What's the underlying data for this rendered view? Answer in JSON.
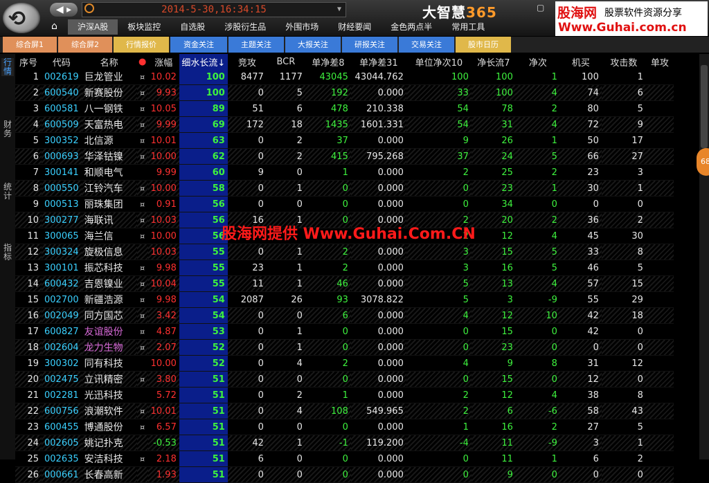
{
  "header": {
    "datetime": "2014-5-30,16:34:15",
    "brand_main": "大智慧",
    "brand_num": "365",
    "watermark_title": "股海网",
    "watermark_sub": "股票软件资源分享",
    "watermark_url": "Www.Guhai.com.cn",
    "menu": [
      "沪深A股",
      "板块监控",
      "自选股",
      "涉股衍生品",
      "外围市场",
      "财经要闻",
      "金色两点半",
      "常用工具"
    ],
    "active_menu": 0
  },
  "tabs": [
    {
      "label": "综合屏1",
      "color": "#e0905a"
    },
    {
      "label": "综合屏2",
      "color": "#e0905a"
    },
    {
      "label": "行情报价",
      "color": "#e0b84a"
    },
    {
      "label": "资金关注",
      "color": "#3a7ad8"
    },
    {
      "label": "主题关注",
      "color": "#3a7ad8"
    },
    {
      "label": "大报关注",
      "color": "#3a7ad8"
    },
    {
      "label": "研报关注",
      "color": "#3a7ad8"
    },
    {
      "label": "交易关注",
      "color": "#3a7ad8"
    },
    {
      "label": "股市日历",
      "color": "#e0b84a"
    }
  ],
  "leftnav": [
    "行情",
    "财务",
    "统计",
    "指标"
  ],
  "table": {
    "headers": [
      "序号",
      "代码",
      "名称",
      "●",
      "涨幅",
      "细水长流↓",
      "竞攻",
      "BCR",
      "单净差8",
      "单净差31",
      "单位净次10",
      "净长流7",
      "净次",
      "机买",
      "攻击数",
      "单攻"
    ],
    "rows": [
      [
        "1",
        "002619",
        "巨龙管业",
        "¤",
        "10.02",
        "100",
        "8477",
        "1177",
        "43045",
        "43044.762",
        "100",
        "100",
        "1",
        "100",
        "1"
      ],
      [
        "2",
        "600540",
        "新赛股份",
        "¤",
        "9.93",
        "100",
        "0",
        "5",
        "192",
        "0.000",
        "33",
        "100",
        "4",
        "74",
        "6"
      ],
      [
        "3",
        "600581",
        "八一钢铁",
        "¤",
        "10.05",
        "89",
        "51",
        "6",
        "478",
        "210.338",
        "54",
        "78",
        "2",
        "80",
        "5"
      ],
      [
        "4",
        "600509",
        "天富热电",
        "¤",
        "9.99",
        "69",
        "172",
        "18",
        "1435",
        "1601.331",
        "54",
        "31",
        "4",
        "72",
        "9"
      ],
      [
        "5",
        "300352",
        "北信源",
        "¤",
        "10.01",
        "63",
        "0",
        "2",
        "37",
        "0.000",
        "9",
        "26",
        "1",
        "50",
        "17"
      ],
      [
        "6",
        "000693",
        "华泽钴镍",
        "¤",
        "10.00",
        "62",
        "0",
        "2",
        "415",
        "795.268",
        "37",
        "24",
        "5",
        "66",
        "27"
      ],
      [
        "7",
        "300141",
        "和顺电气",
        "",
        "9.99",
        "60",
        "9",
        "0",
        "1",
        "0.000",
        "2",
        "25",
        "2",
        "23",
        "3"
      ],
      [
        "8",
        "000550",
        "江铃汽车",
        "¤",
        "10.00",
        "58",
        "0",
        "1",
        "0",
        "0.000",
        "0",
        "23",
        "1",
        "30",
        "1"
      ],
      [
        "9",
        "000513",
        "丽珠集团",
        "¤",
        "0.91",
        "56",
        "0",
        "0",
        "0",
        "0.000",
        "0",
        "34",
        "0",
        "0",
        "0"
      ],
      [
        "10",
        "300277",
        "海联讯",
        "¤",
        "10.03",
        "56",
        "16",
        "1",
        "0",
        "0.000",
        "2",
        "20",
        "2",
        "36",
        "2"
      ],
      [
        "11",
        "300065",
        "海兰信",
        "¤",
        "10.00",
        "56",
        "",
        "",
        "",
        "",
        "2",
        "12",
        "4",
        "45",
        "30"
      ],
      [
        "12",
        "300324",
        "旋极信息",
        "",
        "10.03",
        "55",
        "0",
        "1",
        "2",
        "0.000",
        "3",
        "15",
        "5",
        "33",
        "8"
      ],
      [
        "13",
        "300101",
        "振芯科技",
        "¤",
        "9.98",
        "55",
        "23",
        "1",
        "2",
        "0.000",
        "3",
        "16",
        "5",
        "46",
        "5"
      ],
      [
        "14",
        "600432",
        "吉恩镍业",
        "¤",
        "10.04",
        "55",
        "11",
        "1",
        "46",
        "0.000",
        "5",
        "13",
        "4",
        "57",
        "15"
      ],
      [
        "15",
        "002700",
        "新疆浩源",
        "¤",
        "9.98",
        "54",
        "2087",
        "26",
        "93",
        "3078.822",
        "5",
        "3",
        "-9",
        "55",
        "29"
      ],
      [
        "16",
        "002049",
        "同方国芯",
        "¤",
        "3.42",
        "54",
        "0",
        "0",
        "6",
        "0.000",
        "4",
        "12",
        "10",
        "42",
        "18"
      ],
      [
        "17",
        "600827",
        "友谊股份",
        "¤",
        "4.87",
        "53",
        "0",
        "1",
        "0",
        "0.000",
        "0",
        "15",
        "0",
        "42",
        "0"
      ],
      [
        "18",
        "002604",
        "龙力生物",
        "¤",
        "2.07",
        "52",
        "0",
        "1",
        "0",
        "0.000",
        "0",
        "23",
        "0",
        "0",
        "0"
      ],
      [
        "19",
        "300302",
        "同有科技",
        "",
        "10.00",
        "52",
        "0",
        "4",
        "2",
        "0.000",
        "4",
        "9",
        "8",
        "31",
        "12"
      ],
      [
        "20",
        "002475",
        "立讯精密",
        "¤",
        "3.80",
        "51",
        "0",
        "0",
        "0",
        "0.000",
        "0",
        "15",
        "0",
        "12",
        "0"
      ],
      [
        "21",
        "002281",
        "光迅科技",
        "",
        "5.72",
        "51",
        "0",
        "2",
        "1",
        "0.000",
        "2",
        "12",
        "4",
        "38",
        "8"
      ],
      [
        "22",
        "600756",
        "浪潮软件",
        "¤",
        "10.01",
        "51",
        "0",
        "4",
        "108",
        "549.965",
        "2",
        "6",
        "-6",
        "58",
        "43"
      ],
      [
        "23",
        "600455",
        "博通股份",
        "¤",
        "6.57",
        "51",
        "0",
        "0",
        "0",
        "0.000",
        "1",
        "16",
        "2",
        "27",
        "5"
      ],
      [
        "24",
        "002605",
        "姚记扑克",
        "",
        "-0.53",
        "51",
        "42",
        "1",
        "-1",
        "119.200",
        "-4",
        "11",
        "-9",
        "3",
        "1"
      ],
      [
        "25",
        "002635",
        "安洁科技",
        "¤",
        "2.18",
        "51",
        "6",
        "0",
        "0",
        "0.000",
        "0",
        "11",
        "1",
        "6",
        "2"
      ],
      [
        "26",
        "000661",
        "长春高新",
        "",
        "1.93",
        "51",
        "0",
        "0",
        "0",
        "0.000",
        "0",
        "9",
        "0",
        "0",
        "0"
      ]
    ],
    "purple_rows": [
      16,
      17
    ]
  },
  "overlay_text": "股海网提供 Www.Guhai.Com.CN",
  "side_badge": "68"
}
